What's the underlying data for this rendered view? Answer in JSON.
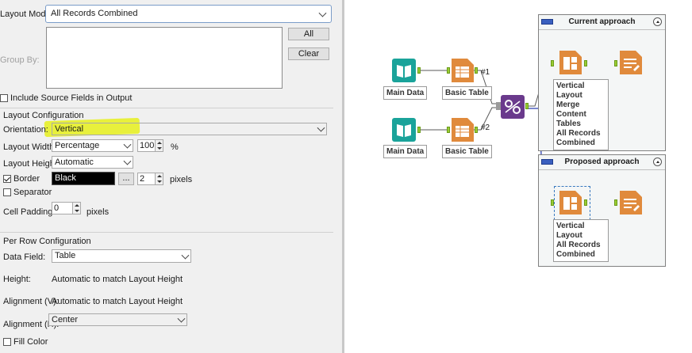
{
  "config": {
    "layout_mode_label": "Layout Mode:",
    "layout_mode_value": "All Records Combined",
    "group_by_label": "Group By:",
    "all_button": "All",
    "clear_button": "Clear",
    "include_source_label": "Include Source Fields in Output",
    "layout_config_header": "Layout Configuration",
    "orientation_label": "Orientation:",
    "orientation_value": "Vertical",
    "layout_width_label": "Layout Width:",
    "layout_width_mode": "Percentage",
    "layout_width_value": "100",
    "layout_width_unit": "%",
    "layout_height_label": "Layout Height:",
    "layout_height_value": "Automatic",
    "border_label": "Border",
    "border_color_name": "Black",
    "border_more": "...",
    "border_width": "2",
    "border_unit": "pixels",
    "separator_label": "Separator",
    "cell_padding_label": "Cell Padding:",
    "cell_padding_value": "0",
    "cell_padding_unit": "pixels",
    "per_row_header": "Per Row Configuration",
    "data_field_label": "Data Field:",
    "data_field_value": "Table",
    "height_label": "Height:",
    "height_value": "Automatic to match Layout Height",
    "align_v_label": "Alignment (V):",
    "align_v_value": "Automatic to match Layout Height",
    "align_h_label": "Alignment (H):",
    "align_h_value": "Center",
    "fill_color_label": "Fill Color"
  },
  "workflow": {
    "main_data_1": "Main Data",
    "basic_table_1": "Basic Table",
    "main_data_2": "Main Data",
    "basic_table_2": "Basic Table",
    "connection_1": "#1",
    "connection_2": "#2",
    "current_approach_title": "Current approach",
    "current_layout_lines": [
      "Vertical Layout",
      "Merge Content",
      "Tables",
      "All Records",
      "Combined"
    ],
    "proposed_approach_title": "Proposed approach",
    "proposed_layout_lines": [
      "Vertical Layout",
      "All Records",
      "Combined"
    ]
  },
  "colors": {
    "highlight": "#e6f000",
    "book_tool": "#1aa39a",
    "table_tool": "#e08a3c",
    "join_tool": "#6a3a8c",
    "container_icon": "#3a5fbf",
    "connection_line": "#5a5a5a",
    "selected_line": "#2a3fb0"
  },
  "icons": [
    "dropdown-icon",
    "checkbox-icon",
    "spinner-icon",
    "book-icon",
    "table-icon",
    "join-icon",
    "layout-icon",
    "render-icon",
    "container-icon",
    "collapse-icon"
  ]
}
